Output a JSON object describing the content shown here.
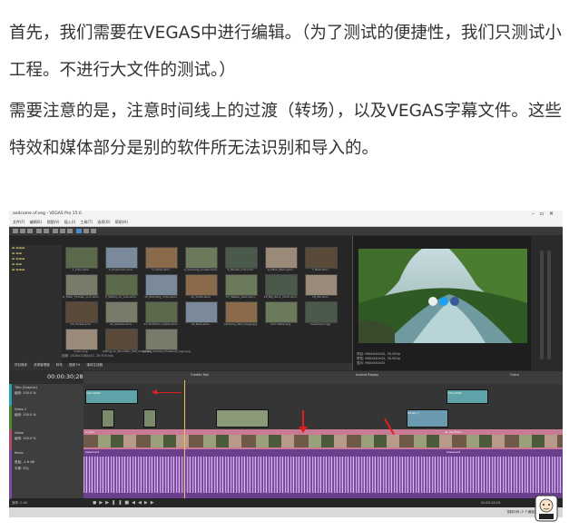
{
  "article": {
    "paragraph1": "首先，我们需要在VEGAS中进行编辑。（为了测试的便捷性，我们只测试小工程。不进行大文件的测试。）",
    "paragraph2": "需要注意的是，注意时间线上的过渡（转场），以及VEGAS字幕文件。这些特效和媒体部分是别的软件所无法识别和导入的。"
  },
  "screenshot": {
    "window_title": "aedcome.vf.veg - VEGAS Pro 15.0",
    "menu": [
      "文件(F)",
      "编辑(E)",
      "视图(V)",
      "插入(I)",
      "工具(T)",
      "选项(O)",
      "帮助(H)"
    ],
    "media_files": [
      "1_Intro.wmv",
      "2_Chamonix.wmv",
      "3_Camp.wmv",
      "4_Camping_Cookie.wmv",
      "5_Woods_trail.wmv",
      "6_Hiker_Back.wmv",
      "7_Bear.wmv",
      "8_Hiker_Throws_rock.wmv",
      "9_Sitting_on_rock.wmv",
      "10_Stacking_rocks.wmv",
      "11_Turtle.wmv",
      "17_Walker_back.wmv",
      "18_Big_Rock_climb.wmv",
      "19_Elk.wmv",
      "20_Forest.wmv",
      "20_Alberta.wmv",
      "21_Northern_Lights.wmv",
      "22_Bear.wmv",
      "camping_Still_image.jpg",
      "intro-0002.png",
      "basement.ogg",
      "Outro.png",
      "Sitting_on_Mountain_Still_image.jpg",
      "Vimeo_Youtube_Facebook_logo.png"
    ],
    "explorer_status": "视频: 1920x1080x32, 29.970 fps",
    "explorer_tabs": [
      "项目媒体",
      "资源管理器",
      "转场",
      "视频 FX",
      "媒体生成器"
    ],
    "preview_info": [
      "项目: 960x540x32, 30.000p",
      "预览: 960x540x32, 30.000p",
      "显示: 960x540x32"
    ],
    "timecode": "00:00:30;28",
    "tracks": [
      {
        "name": "Title (Graphic)",
        "level": "级别: 100.0 %"
      },
      {
        "name": "Video 2",
        "level": "级别: 100.0 %"
      },
      {
        "name": "Video",
        "level": "级别: 100.0 %"
      },
      {
        "name": "Music",
        "level": "音量: -1.6 dB",
        "pan": "平移: 中心"
      }
    ],
    "markers": [
      "Credits Roll",
      "Instant Replay",
      "Outro"
    ],
    "clip_labels": [
      "intro-0002",
      "1_Intro",
      "Vimeo_Y",
      "intro-0002",
      "21_Northern",
      "basement",
      "basement"
    ],
    "rate": "速率: 0.00",
    "transport_time": "00:00:28;28",
    "record_time": "录制时间 (2 个通道)"
  },
  "colors": {
    "text": "#333333",
    "timeline_bg": "#2e2e2e",
    "video_clip": "#c97b95",
    "audio_clip": "#7b4aa0",
    "title_clip": "#5fa3a8",
    "arrow": "#e02020"
  },
  "icons": [
    "folder-icon",
    "play-icon",
    "stop-icon",
    "loop-icon",
    "arrow-annotation-icon",
    "mascot-icon"
  ]
}
